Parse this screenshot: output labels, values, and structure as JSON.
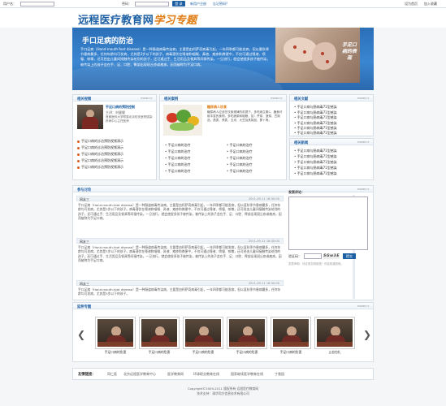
{
  "topbar": {
    "username_label": "用户名：",
    "password_label": "密码：",
    "login_label": "登 录",
    "register_label": "新用户注册",
    "forgot_label": "忘记密码?",
    "set_home_label": "设为首页",
    "add_fav_label": "加入收藏"
  },
  "header": {
    "logo_main": "远程医疗教育网",
    "logo_sub": "学习专题"
  },
  "banner": {
    "title": "手口足病的防治",
    "text": "手口足病（Hand-mouth-foot disease）是一种肠道病毒传染病，主要是由柯萨奇病毒引起，一年四季都可能发病，但以夏秋季节患病最多，任何年龄均可发病，尤其是3岁以下的孩子。病毒潜伏在唾液和咽喉、鼻液、疱疹和粪便中，不仅可通过唾液、喷嚏、咳嗽，还可经由儿童间接触传染给别的孩子，还可通过手、生活用品及餐具等间接传染。一旦流行，就会使很多孩子被传染，被传染上的孩子会在手、足、口腔、臀部出现斑丘疹或疱疹。因而被称为手足口病。",
    "caption": "手足口病的表现"
  },
  "video_panel": {
    "title": "相关视频",
    "more": "more>>",
    "video_title": "手足口病的预防控制",
    "speaker": "主讲：刘健健",
    "org": "首都医科大学附属北京佑安医院感染肝病中心主任医师",
    "items": [
      "手足口病的诊治预防视频演示",
      "手足口病的诊治预防视频演示",
      "手足口病的诊治预防视频演示",
      "手足口病的诊治预防视频演示",
      "手足口病的诊治预防视频演示"
    ]
  },
  "case_panel": {
    "title": "相关案例",
    "more": "more>>",
    "feature_title": "糖尿病人饮食",
    "feature_text": "糖尿病人应该在饮食规律的前提下，多吃维生素C、膳食纤维丰富的食物，多吃蔬菜和粗粮，如：芹菜、菠菜、豆制品、燕麦、荞麦、玉米、大豆及其制品、萝卜等。",
    "col1": [
      "手足口病的治疗",
      "手足口病的治疗",
      "手足口病的治疗",
      "手足口病的治疗",
      "手足口病的治疗"
    ],
    "col2": [
      "手足口病的治疗",
      "手足口病的治疗",
      "手足口病的治疗",
      "手足口病的治疗",
      "手足口病的治疗"
    ]
  },
  "article_panel": {
    "title": "相关文献",
    "more": "more>>",
    "items": [
      "手足口病与肠病毒71型感染",
      "手足口病与肠病毒71型感染",
      "手足口病与肠病毒71型感染",
      "手足口病与肠病毒71型感染",
      "手足口病与肠病毒71型感染",
      "手足口病与肠病毒71型感染"
    ]
  },
  "news_panel": {
    "title": "相关新闻",
    "more": "more>>",
    "items": [
      "手足口病与肠病毒71型感染",
      "手足口病与肠病毒71型感染",
      "手足口病与肠病毒71型感染",
      "手足口病与肠病毒71型感染",
      "手足口病与肠病毒71型感染"
    ]
  },
  "discussion": {
    "title": "参与讨论",
    "more": "more>>",
    "messages": [
      {
        "user": "网友三",
        "time": "2011-09-11  16:30:00",
        "text": "手口足病（Hand-mouth-foot disease）是一种肠道病毒传染病，主要是由柯萨奇病毒引起，一年四季都可能发病，但以夏秋季节患病最多，任何年龄均可发病，尤其是3岁以下的孩子。病毒潜伏在唾液和咽喉、鼻液、疱疹和粪便中，不仅可通过唾液、喷嚏、咳嗽，还可经由儿童间接触传染给别的孩子，还可通过手、生活用品及餐具等间接传染。一旦流行，就会使很多孩子被传染，被传染上的孩子会在手、足、口腔、臀部出现斑丘疹或疱疹。因而被称为手足口病。"
      },
      {
        "user": "网友三",
        "time": "2011-09-11  16:30:00",
        "text": "手口足病（Hand-mouth-foot disease）是一种肠道病毒传染病，主要是由柯萨奇病毒引起，一年四季都可能发病，但以夏秋季节患病最多，任何年龄均可发病，尤其是3岁以下的孩子。病毒潜伏在唾液和咽喉、鼻液、疱疹和粪便中，不仅可通过唾液、喷嚏、咳嗽，还可经由儿童间接触传染给别的孩子，还可通过手、生活用品及餐具等间接传染。一旦流行，就会使很多孩子被传染，被传染上的孩子会在手、足、口腔、臀部出现斑丘疹或疱疹。因而被称为手足口病。"
      },
      {
        "user": "网友三",
        "time": "2011-09-11  16:30:00",
        "text": "手口足病（Hand-mouth-foot disease）是一种肠道病毒传染病，主要是由柯萨奇病毒引起，一年四季都可能发病，但以夏秋季节患病最多，任何年龄均可发病，尤其是3岁以下的孩子。"
      }
    ],
    "comment_label": "发表评论：",
    "captcha_label": "验证码：",
    "captcha_code": "SGw3E",
    "submit_label": "提交",
    "notice": "发表声明：评论请文明用语！你会知道其他。"
  },
  "videos": {
    "title": "延伸专题",
    "more": "more>>",
    "items": [
      "手足口病的危害",
      "手足口病的危害",
      "手足口病的危害",
      "手足口病的危害",
      "手足口病的危害",
      "止血包扎"
    ]
  },
  "links": {
    "label": "友情链接：",
    "items": [
      "同仁医",
      "北京远程医学教育中心",
      "医学教育网",
      "环球职业教育在线",
      "国家继续医学教育在线",
      "丁香园"
    ]
  },
  "footer": {
    "copyright": "Copyright©2009-2011 版权所有  远程医疗教育网",
    "support": "技术支持：清华同方信息技术有限公司"
  }
}
